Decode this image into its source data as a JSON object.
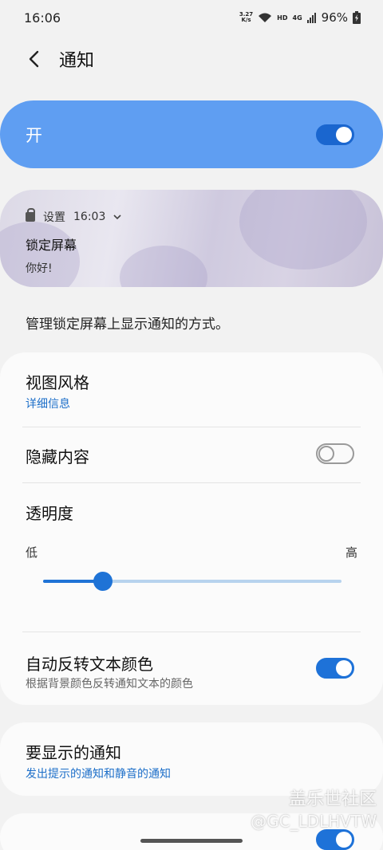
{
  "status_bar": {
    "time": "16:06",
    "net_speed_top": "3.27",
    "net_speed_bottom": "K/s",
    "hd_label": "HD",
    "signal_label": "4G",
    "battery": "96%"
  },
  "header": {
    "title": "通知"
  },
  "master": {
    "label": "开",
    "enabled": true
  },
  "preview": {
    "app_name": "设置",
    "time": "16:03",
    "title": "锁定屏幕",
    "body": "你好!"
  },
  "description": "管理锁定屏幕上显示通知的方式。",
  "settings": {
    "view_style": {
      "title": "视图风格",
      "value": "详细信息"
    },
    "hide_content": {
      "title": "隐藏内容",
      "enabled": false
    },
    "transparency": {
      "title": "透明度",
      "low_label": "低",
      "high_label": "高",
      "level_percent": 20
    },
    "auto_invert": {
      "title": "自动反转文本颜色",
      "subtitle": "根据背景颜色反转通知文本的颜色",
      "enabled": true
    },
    "notifications_to_show": {
      "title": "要显示的通知",
      "value": "发出提示的通知和静音的通知"
    }
  },
  "watermark": {
    "line1": "盖乐世社区",
    "line2": "@GC_LDLHVTW"
  },
  "colors": {
    "accent": "#1f73d6",
    "master_bg": "#5f9ef2",
    "link": "#1d6fc9"
  }
}
